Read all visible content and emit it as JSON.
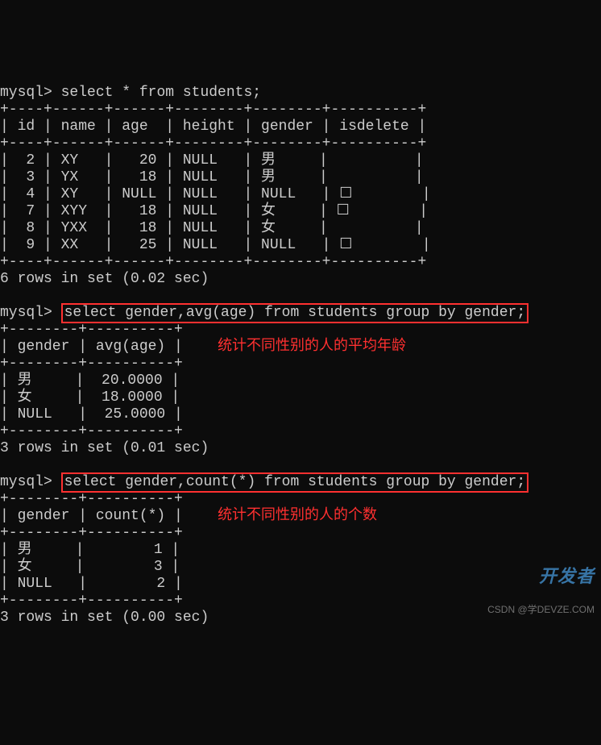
{
  "prompt": "mysql>",
  "queries": {
    "q1": "select * from students;",
    "q2": "select gender,avg(age) from students group by gender;",
    "q3": "select gender,count(*) from students group by gender;"
  },
  "table1": {
    "sep_top": "+----+------+------+--------+--------+----------+",
    "header": "| id | name | age  | height | gender | isdelete |",
    "sep_mid": "+----+------+------+--------+--------+----------+",
    "rows": [
      "|  2 | XY   |   20 | NULL   | 男     |          |",
      "|  3 | YX   |   18 | NULL   | 男     |          |",
      "|  4 | XY   | NULL | NULL   | NULL   | ☐        |",
      "|  7 | XYY  |   18 | NULL   | 女     | ☐        |",
      "|  8 | YXX  |   18 | NULL   | 女     |          |",
      "|  9 | XX   |   25 | NULL   | NULL   | ☐        |"
    ],
    "sep_bot": "+----+------+------+--------+--------+----------+",
    "status": "6 rows in set (0.02 sec)"
  },
  "table2": {
    "sep_top": "+--------+----------+",
    "header": "| gender | avg(age) |",
    "sep_mid": "+--------+----------+",
    "rows": [
      "| 男     |  20.0000 |",
      "| 女     |  18.0000 |",
      "| NULL   |  25.0000 |"
    ],
    "sep_bot": "+--------+----------+",
    "status": "3 rows in set (0.01 sec)",
    "annotation": "统计不同性别的人的平均年龄"
  },
  "table3": {
    "sep_top": "+--------+----------+",
    "header": "| gender | count(*) |",
    "sep_mid": "+--------+----------+",
    "rows": [
      "| 男     |        1 |",
      "| 女     |        3 |",
      "| NULL   |        2 |"
    ],
    "sep_bot": "+--------+----------+",
    "status": "3 rows in set (0.00 sec)",
    "annotation": "统计不同性别的人的个数"
  },
  "watermark": {
    "brand": "开发者",
    "sub": "CSDN @学DEVZE.COM"
  },
  "chart_data": {
    "type": "table",
    "title": "students",
    "columns": [
      "id",
      "name",
      "age",
      "height",
      "gender",
      "isdelete"
    ],
    "rows": [
      {
        "id": 2,
        "name": "XY",
        "age": 20,
        "height": null,
        "gender": "男",
        "isdelete": null
      },
      {
        "id": 3,
        "name": "YX",
        "age": 18,
        "height": null,
        "gender": "男",
        "isdelete": null
      },
      {
        "id": 4,
        "name": "XY",
        "age": null,
        "height": null,
        "gender": null,
        "isdelete": false
      },
      {
        "id": 7,
        "name": "XYY",
        "age": 18,
        "height": null,
        "gender": "女",
        "isdelete": false
      },
      {
        "id": 8,
        "name": "YXX",
        "age": 18,
        "height": null,
        "gender": "女",
        "isdelete": null
      },
      {
        "id": 9,
        "name": "XX",
        "age": 25,
        "height": null,
        "gender": null,
        "isdelete": false
      }
    ],
    "aggregates": {
      "avg_age_by_gender": {
        "男": 20.0,
        "女": 18.0,
        "NULL": 25.0
      },
      "count_by_gender": {
        "男": 1,
        "女": 3,
        "NULL": 2
      }
    }
  }
}
